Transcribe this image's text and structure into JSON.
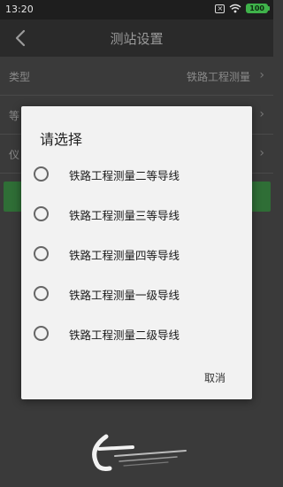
{
  "status_bar": {
    "time": "13:20",
    "battery": "100",
    "icons": [
      "notification-x-icon",
      "wifi-icon",
      "battery-icon"
    ]
  },
  "header": {
    "title": "测站设置",
    "back_icon": "back-arrow-icon"
  },
  "background_rows": [
    {
      "label": "类型",
      "value": "铁路工程测量"
    },
    {
      "label": "等",
      "value": ""
    },
    {
      "label": "仪",
      "value": ""
    }
  ],
  "dialog": {
    "title": "请选择",
    "options": [
      {
        "label": "铁路工程测量二等导线",
        "selected": false
      },
      {
        "label": "铁路工程测量三等导线",
        "selected": false
      },
      {
        "label": "铁路工程测量四等导线",
        "selected": false
      },
      {
        "label": "铁路工程测量一级导线",
        "selected": false
      },
      {
        "label": "铁路工程测量二级导线",
        "selected": false
      }
    ],
    "cancel_label": "取消"
  },
  "colors": {
    "accent_green": "#2f6e36",
    "battery_green": "#3fb24a",
    "dialog_bg": "#f2f2f2"
  }
}
